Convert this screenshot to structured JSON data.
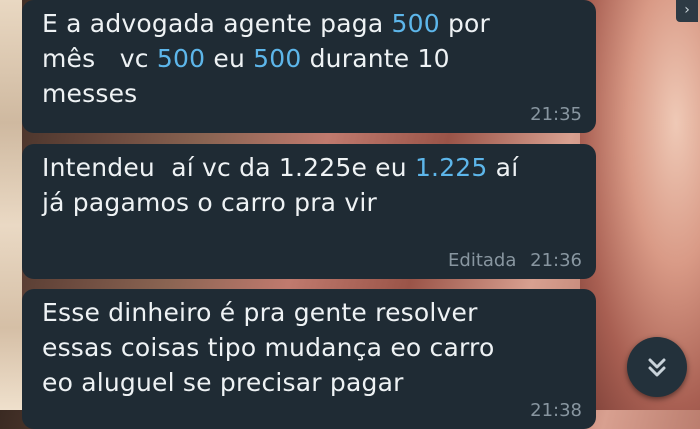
{
  "messages": [
    {
      "parts": [
        {
          "t": "E a advogada agente paga ",
          "hl": false
        },
        {
          "t": "500",
          "hl": true
        },
        {
          "t": " por\nmês   vc ",
          "hl": false
        },
        {
          "t": "500",
          "hl": true
        },
        {
          "t": " eu ",
          "hl": false
        },
        {
          "t": "500",
          "hl": true
        },
        {
          "t": " durante 10\nmesses",
          "hl": false
        }
      ],
      "time": "21:35",
      "edited": ""
    },
    {
      "parts": [
        {
          "t": "Intendeu  aí vc da 1.225e eu ",
          "hl": false
        },
        {
          "t": "1.225",
          "hl": true
        },
        {
          "t": " aí\njá pagamos o carro pra vir",
          "hl": false
        }
      ],
      "time": "21:36",
      "edited": "Editada"
    },
    {
      "parts": [
        {
          "t": "Esse dinheiro é pra gente resolver\nessas coisas tipo mudança eo carro\neo aluguel se precisar pagar",
          "hl": false
        }
      ],
      "time": "21:38",
      "edited": ""
    }
  ],
  "icons": {
    "scroll_down": "double-chevron-down-icon",
    "corner": "chevron-icon"
  },
  "colors": {
    "bubble": "#1f2b34",
    "highlight": "#5db6ea",
    "meta": "#8896a0",
    "text": "#eef2f4"
  }
}
